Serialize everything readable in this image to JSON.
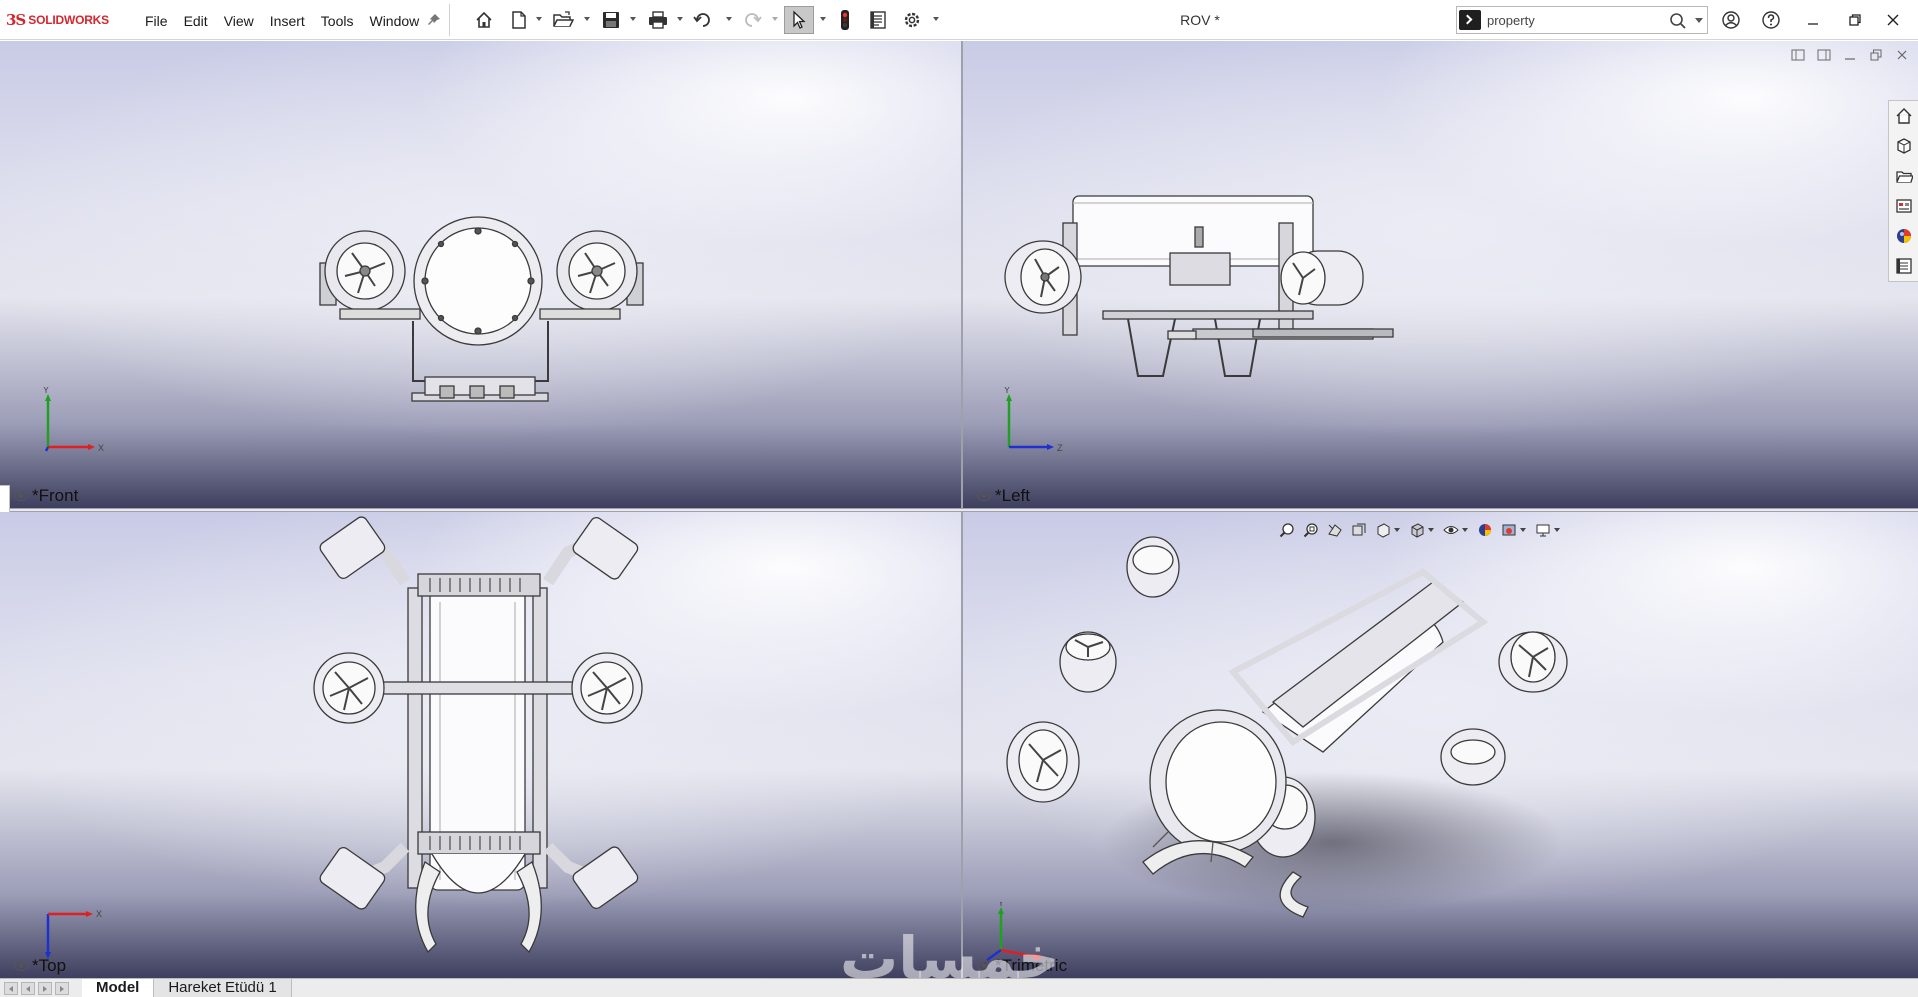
{
  "app": {
    "logo_mark": "3S",
    "logo_text": "SOLIDWORKS",
    "document_title": "ROV *"
  },
  "menu": [
    "File",
    "Edit",
    "View",
    "Insert",
    "Tools",
    "Window"
  ],
  "toolbar_icons": [
    "home-icon",
    "new-document-icon",
    "open-folder-icon",
    "save-icon",
    "print-icon",
    "undo-icon",
    "redo-icon",
    "select-cursor-icon",
    "rebuild-icon",
    "file-properties-icon",
    "options-gear-icon"
  ],
  "search": {
    "value": "property"
  },
  "window_controls": [
    "user-icon",
    "help-icon",
    "minimize-icon",
    "restore-icon",
    "close-icon"
  ],
  "viewports": {
    "front": {
      "label": "*Front",
      "axes": [
        "Y",
        "X"
      ]
    },
    "left": {
      "label": "*Left",
      "axes": [
        "Y",
        "Z"
      ]
    },
    "top": {
      "label": "*Top",
      "axes": [
        "X",
        "Z"
      ]
    },
    "trimetric": {
      "label": "*Trimetric",
      "axes": [
        "Y",
        "Z",
        "X"
      ]
    }
  },
  "task_pane": [
    "home-icon",
    "3d-parts-icon",
    "design-library-icon",
    "file-explorer-icon",
    "appearances-icon",
    "custom-properties-icon"
  ],
  "heads_up_toolbar": [
    "zoom-to-fit-icon",
    "zoom-area-icon",
    "previous-view-icon",
    "section-view-icon",
    "view-orientation-icon",
    "display-style-icon",
    "hide-show-icon",
    "edit-appearance-icon",
    "apply-scene-icon",
    "view-settings-icon"
  ],
  "watermark": "خمسات",
  "bottom_tabs": {
    "model": "Model",
    "motion": "Hareket Etüdü 1"
  },
  "colors": {
    "brand_red": "#d3272f",
    "viewport_top": "#c9cbe6",
    "viewport_bottom": "#3e3f5e",
    "axis_x": "#e02020",
    "axis_y": "#20a020",
    "axis_z": "#2030d0"
  }
}
